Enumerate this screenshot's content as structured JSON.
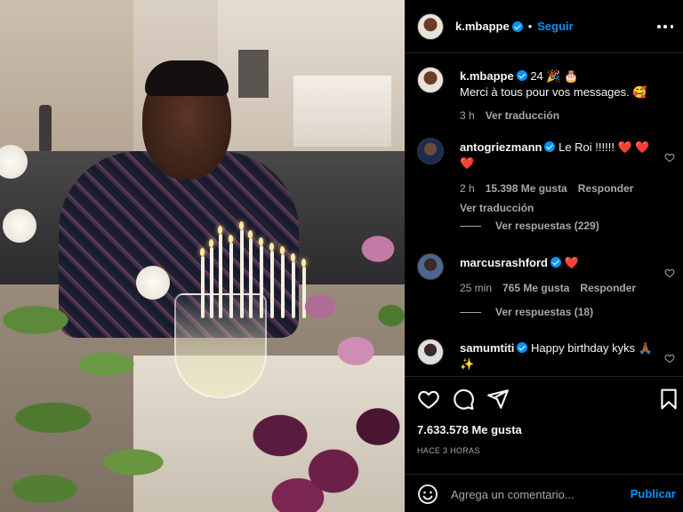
{
  "post": {
    "author": "k.mbappe",
    "follow_label": "Seguir",
    "separator": "•"
  },
  "caption": {
    "username": "k.mbappe",
    "text_line1": "24 🎉 🎂",
    "text_line2": "Merci à tous pour vos messages. 🥰",
    "time": "3 h",
    "translate": "Ver traducción"
  },
  "comments": [
    {
      "username": "antogriezmann",
      "text": "Le Roi !!!!!! ❤️ ❤️ ❤️",
      "time": "2 h",
      "likes": "15.398 Me gusta",
      "reply": "Responder",
      "translate": "Ver traducción",
      "replies_label": "Ver respuestas (229)"
    },
    {
      "username": "marcusrashford",
      "text": "❤️",
      "time": "25 min",
      "likes": "765 Me gusta",
      "reply": "Responder",
      "replies_label": "Ver respuestas (18)"
    },
    {
      "username": "samumtiti",
      "text": "Happy birthday kyks 🙏🏾 ✨"
    }
  ],
  "stats": {
    "likes": "7.633.578 Me gusta",
    "posted_ago": "HACE 3 HORAS"
  },
  "composer": {
    "placeholder": "Agrega un comentario...",
    "publish_label": "Publicar"
  },
  "icons": {
    "like": "heart-icon",
    "comment": "comment-icon",
    "share": "share-icon",
    "save": "bookmark-icon",
    "emoji": "smiley-icon",
    "more": "more-options-icon"
  },
  "colors": {
    "accent": "#0095f6",
    "background": "#000000",
    "secondary_text": "#a8a8a8",
    "heart": "#ed4956"
  }
}
